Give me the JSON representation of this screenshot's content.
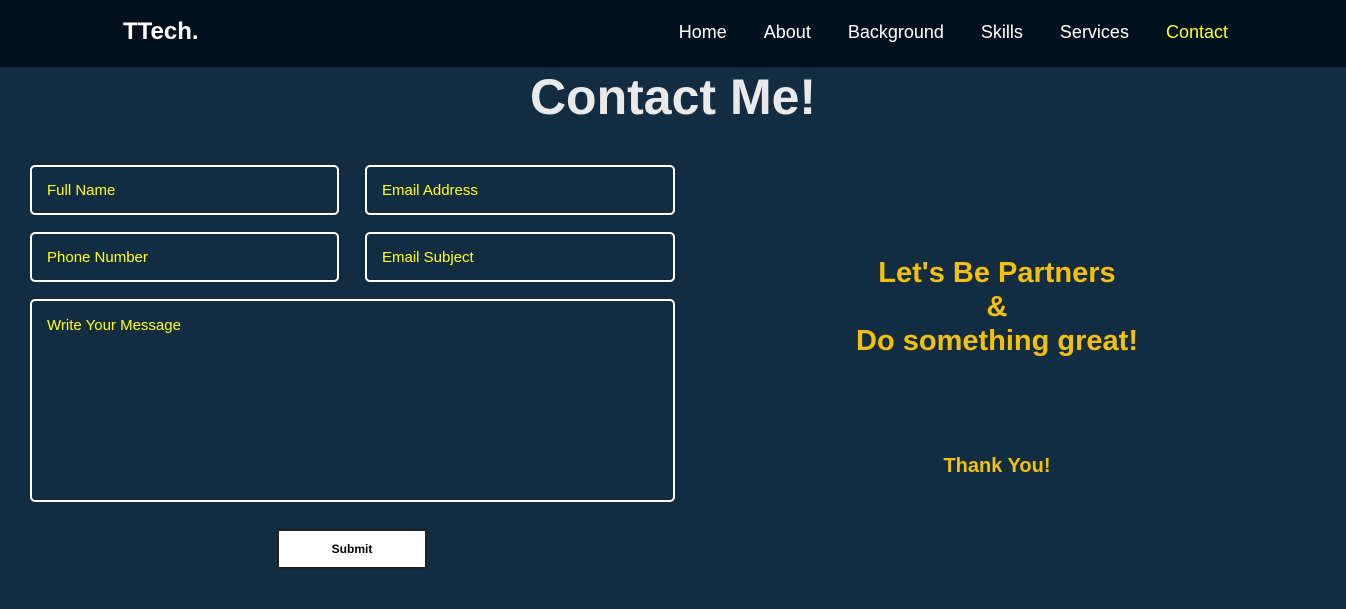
{
  "brand": "TTech.",
  "nav": {
    "items": [
      {
        "label": "Home",
        "active": false
      },
      {
        "label": "About",
        "active": false
      },
      {
        "label": "Background",
        "active": false
      },
      {
        "label": "Skills",
        "active": false
      },
      {
        "label": "Services",
        "active": false
      },
      {
        "label": "Contact",
        "active": true
      }
    ]
  },
  "page": {
    "title": "Contact Me!"
  },
  "form": {
    "full_name_placeholder": "Full Name",
    "email_placeholder": "Email Address",
    "phone_placeholder": "Phone Number",
    "subject_placeholder": "Email Subject",
    "message_placeholder": "Write Your Message",
    "submit_label": "Submit"
  },
  "side": {
    "tagline_line1": "Let's Be Partners",
    "tagline_line2": "&",
    "tagline_line3": "Do something great!",
    "thank_you": "Thank You!"
  },
  "colors": {
    "background": "#122c42",
    "navbar": "#01101c",
    "accent_yellow": "#ffff14",
    "tagline_gold": "#f5c00c"
  }
}
